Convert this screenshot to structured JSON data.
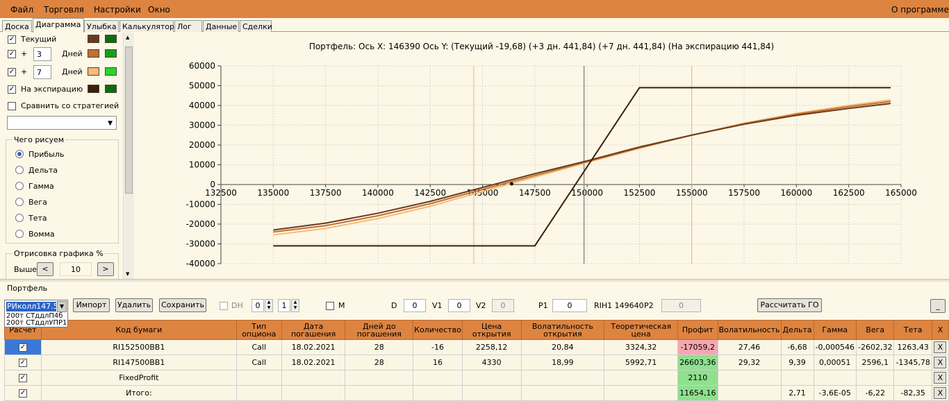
{
  "menu": {
    "file": "Файл",
    "trade": "Торговля",
    "settings": "Настройки",
    "window": "Окно",
    "about": "О программе"
  },
  "tabs": [
    "Доска",
    "Диаграмма",
    "Улыбка",
    "Калькулятор",
    "Лог",
    "Данные",
    "Сделки"
  ],
  "left": {
    "current": "Текущий",
    "plus": "+",
    "days1": "3",
    "days2": "7",
    "days_label": "Дней",
    "expiration": "На экспирацию",
    "compare": "Сравнить со стратегией",
    "group_title": "Чего рисуем",
    "radios": [
      "Прибыль",
      "Дельта",
      "Гамма",
      "Вега",
      "Тета",
      "Вомма"
    ],
    "render_title": "Отрисовка графика %",
    "higher": "Выше",
    "higher_value": "10",
    "left_btn": "<",
    "right_btn": ">"
  },
  "swatches": {
    "current": [
      "#6b3a1a",
      "#0a6e0a"
    ],
    "plus3": [
      "#c07030",
      "#16a016"
    ],
    "plus7": [
      "#f7bb78",
      "#2ad42a"
    ],
    "expiration": [
      "#3d1e0a",
      "#0a6e0a"
    ]
  },
  "chart_title": "Портфель: Ось X:  146390 Ось Y:   (Текущий -19,68)  (+3 дн. 441,84)  (+7 дн. 441,84)  (На экспирацию 441,84)",
  "chart_data": {
    "type": "line",
    "xlim": [
      132500,
      165000
    ],
    "ylim": [
      -40000,
      60000
    ],
    "xticks": [
      132500,
      135000,
      137500,
      140000,
      142500,
      145000,
      147500,
      150000,
      152500,
      155000,
      157500,
      160000,
      162500,
      165000
    ],
    "yticks": [
      -40000,
      -30000,
      -20000,
      -10000,
      0,
      10000,
      20000,
      30000,
      40000,
      50000,
      60000
    ],
    "vlines_pink": [
      144580,
      155000
    ],
    "vline_gray": 149850,
    "marker": [
      146390,
      0
    ],
    "grid": true,
    "series": [
      {
        "x": [
          135000,
          147500,
          152500,
          164500
        ],
        "y": [
          -31000,
          -31000,
          49000,
          49000
        ],
        "color": "#3d1e0a"
      },
      {
        "x": [
          135000,
          137500,
          140000,
          142500,
          145000,
          147500,
          150000,
          152500,
          155000,
          157500,
          160000,
          162500,
          164500
        ],
        "y": [
          -23000,
          -19500,
          -14500,
          -8500,
          -1500,
          5500,
          12000,
          19000,
          25000,
          30500,
          35000,
          38500,
          41000
        ],
        "color": "#6b3a1a"
      },
      {
        "x": [
          135000,
          137500,
          140000,
          142500,
          145000,
          147500,
          150000,
          152500,
          155000,
          157500,
          160000,
          162500,
          164500
        ],
        "y": [
          -24000,
          -20800,
          -15800,
          -9700,
          -2500,
          4600,
          11600,
          18600,
          25000,
          30800,
          35600,
          39400,
          42000
        ],
        "color": "#c07030"
      },
      {
        "x": [
          135000,
          137500,
          140000,
          142500,
          145000,
          147500,
          150000,
          152500,
          155000,
          157500,
          160000,
          162500,
          164500
        ],
        "y": [
          -25500,
          -22200,
          -17200,
          -11000,
          -3500,
          3800,
          11200,
          18300,
          25000,
          31000,
          36000,
          40000,
          42800
        ],
        "color": "#f7bb78"
      }
    ]
  },
  "portfolio": {
    "label": "Портфель",
    "selected": "РИколл147.5",
    "options": [
      "200т СТддлП4б",
      "200т СТддлУПР1"
    ],
    "import": "Импорт",
    "delete": "Удалить",
    "save": "Сохранить",
    "dh": "DH",
    "spin1": "0",
    "spin2": "1",
    "m": "M",
    "d_label": "D",
    "d_val": "0",
    "v1_label": "V1",
    "v1_val": "0",
    "v2_label": "V2",
    "v2_val": "0",
    "p1_label": "P1",
    "p1_val": "0",
    "rih": "RIH1 149640",
    "p2_label": "P2",
    "p2_val": "0",
    "calc_go": "Рассчитать ГО",
    "minimize": "_"
  },
  "table": {
    "headers": [
      "Расчет",
      "Код бумаги",
      "Тип опциона",
      "Дата погашения",
      "Дней до погашения",
      "Количество",
      "Цена открытия",
      "Волатильность открытия",
      "Теоретическая цена",
      "Профит",
      "Волатильность",
      "Дельта",
      "Гамма",
      "Вега",
      "Тета",
      "X"
    ],
    "rows": [
      [
        "",
        "RI152500BB1",
        "Call",
        "18.02.2021",
        "28",
        "-16",
        "2258,12",
        "20,84",
        "3324,32",
        "-17059,2",
        "27,46",
        "-6,68",
        "-0,000546",
        "-2602,32",
        "1263,43",
        "X"
      ],
      [
        "",
        "RI147500BB1",
        "Call",
        "18.02.2021",
        "28",
        "16",
        "4330",
        "18,99",
        "5992,71",
        "26603,36",
        "29,32",
        "9,39",
        "0,00051",
        "2596,1",
        "-1345,78",
        "X"
      ],
      [
        "",
        "FixedProfit",
        "",
        "",
        "",
        "",
        "",
        "",
        "",
        "2110",
        "",
        "",
        "",
        "",
        "",
        "X"
      ],
      [
        "",
        "Итого:",
        "",
        "",
        "",
        "",
        "",
        "",
        "",
        "11654,16",
        "",
        "2,71",
        "-3,6E-05",
        "-6,22",
        "-82,35",
        "X"
      ]
    ]
  }
}
